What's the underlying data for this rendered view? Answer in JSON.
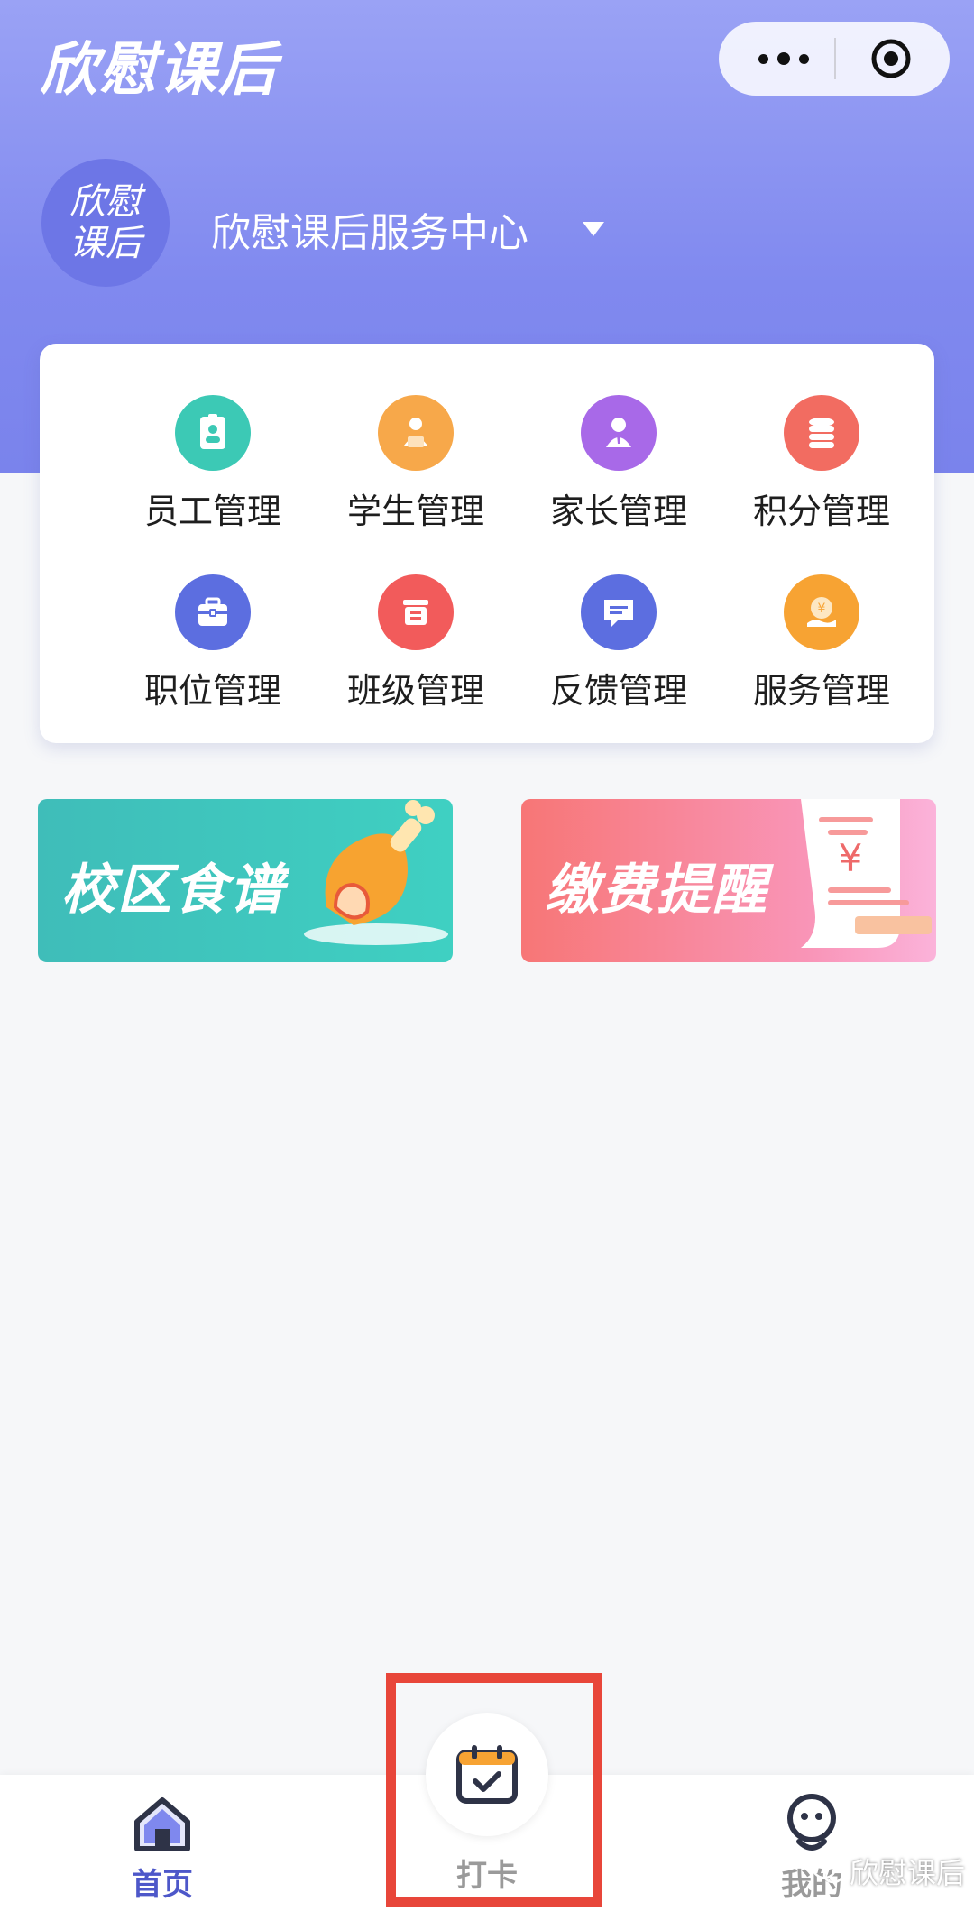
{
  "header": {
    "app_title": "欣慰课后",
    "capsule_icons": [
      "more-dots-icon",
      "target-circle-icon"
    ],
    "logo_text_line1": "欣慰",
    "logo_text_line2": "课后",
    "center_name": "欣慰课后服务中心"
  },
  "menu": {
    "items": [
      {
        "label": "员工管理",
        "icon": "id-badge-icon",
        "color": "#3cc9b5"
      },
      {
        "label": "学生管理",
        "icon": "student-icon",
        "color": "#f7a84a"
      },
      {
        "label": "家长管理",
        "icon": "parent-person-icon",
        "color": "#a869e8"
      },
      {
        "label": "积分管理",
        "icon": "coins-stack-icon",
        "color": "#f26c61"
      },
      {
        "label": "职位管理",
        "icon": "briefcase-icon",
        "color": "#5c6ee0"
      },
      {
        "label": "班级管理",
        "icon": "class-box-icon",
        "color": "#f25b5b"
      },
      {
        "label": "反馈管理",
        "icon": "feedback-bubble-icon",
        "color": "#5c6ee0"
      },
      {
        "label": "服务管理",
        "icon": "service-coin-icon",
        "color": "#f7a333"
      }
    ]
  },
  "banners": {
    "food": {
      "label": "校区食谱",
      "icon": "drumstick-icon"
    },
    "fee": {
      "label": "缴费提醒",
      "icon": "receipt-yuan-icon",
      "symbol": "¥"
    }
  },
  "tabbar": {
    "home": {
      "label": "首页",
      "icon": "home-icon",
      "color": "#4d57c9"
    },
    "clockin": {
      "label": "打卡",
      "icon": "calendar-check-icon"
    },
    "me": {
      "label": "我的",
      "icon": "user-face-icon"
    }
  },
  "watermark": {
    "label": "欣慰课后",
    "icon": "wechat-icon"
  }
}
